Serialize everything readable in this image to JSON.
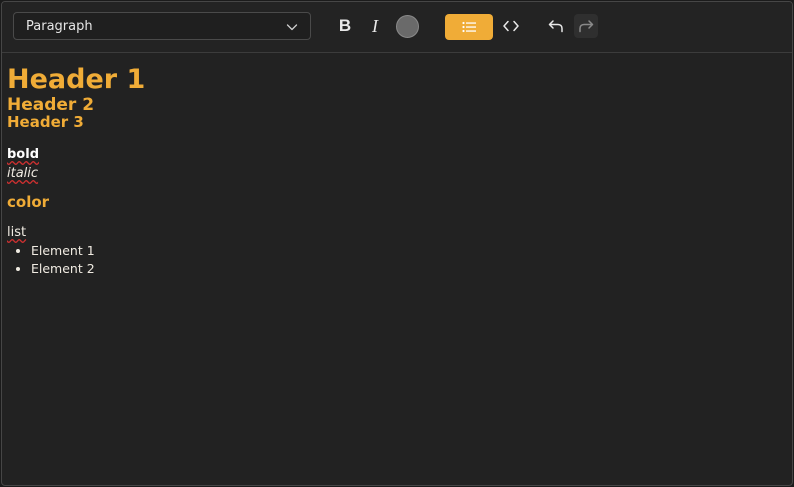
{
  "toolbar": {
    "block_type": {
      "selected": "Paragraph",
      "icon": "chevron-down-icon"
    },
    "bold_label": "B",
    "italic_label": "I",
    "text_color_swatch": "#6a6a6a",
    "list_icon": "bulleted-list-icon",
    "code_icon": "code-icon",
    "undo_icon": "undo-icon",
    "redo_icon": "redo-icon",
    "accent_color": "#f0ac37"
  },
  "content": {
    "heading1": "Header 1",
    "heading2": "Header 2",
    "heading3": "Header 3",
    "bold_text": "bold",
    "italic_text": "italic",
    "color_text": "color",
    "list_label": "list",
    "list_items": [
      "Element 1",
      "Element 2"
    ]
  }
}
